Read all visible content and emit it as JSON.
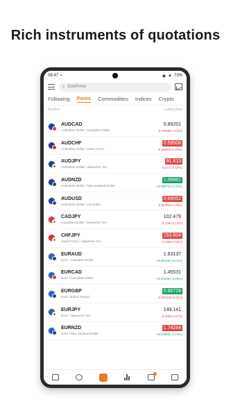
{
  "headline": "Rich instruments of quotations",
  "status": {
    "time": "08:47",
    "battery": "73%"
  },
  "search": {
    "placeholder": "DooPrime"
  },
  "tabs": [
    "Following",
    "Forex",
    "Commodities",
    "Indices",
    "Crypto"
  ],
  "active_tab": "Forex",
  "columns": {
    "symbol": "Symbol",
    "latest": "Latest price"
  },
  "rows": [
    {
      "symbol": "AUDCAD",
      "desc": "Australian Dollar / Canadian Dollar",
      "price": "0.89201",
      "change": "-0.00088(-0.03%)",
      "dir": "neutral",
      "chg": "neg"
    },
    {
      "symbol": "AUDCHF",
      "desc": "Australian Dollar / Swiss Franc",
      "price": "0.59508",
      "change": "-0.00050(-0.29%)",
      "dir": "down",
      "chg": "neg"
    },
    {
      "symbol": "AUDJPY",
      "desc": "Australian Dollar / Japanese Yen",
      "price": "91.413",
      "change": "-0.171(-0.19%)",
      "dir": "down",
      "chg": "neg"
    },
    {
      "symbol": "AUDNZD",
      "desc": "Australian Dollar / New Zealand Dollar",
      "price": "1.06861",
      "change": "+0.00071(+1.31%)",
      "dir": "up",
      "chg": "pos"
    },
    {
      "symbol": "AUDUSD",
      "desc": "Australian Dollar / US Dollar",
      "price": "0.66052",
      "change": "-0.00050(-0.26%)",
      "dir": "down",
      "chg": "neg"
    },
    {
      "symbol": "CADJPY",
      "desc": "Canadian Dollar / Japanese Yen",
      "price": "102.479",
      "change": "-0.138(-0.13%)",
      "dir": "neutral",
      "chg": "neg"
    },
    {
      "symbol": "CHFJPY",
      "desc": "Swiss Franc / Japanese Yen",
      "price": "153.604",
      "change": "-0.158(-0.10%)",
      "dir": "down",
      "chg": "neg"
    },
    {
      "symbol": "EURAUD",
      "desc": "Euro / Australian Dollar",
      "price": "1.63137",
      "change": "+0.00225(+0.14%)",
      "dir": "neutral",
      "chg": "pos"
    },
    {
      "symbol": "EURCAD",
      "desc": "Euro / Canadian Dollar",
      "price": "1.45531",
      "change": "+0.00136(+0.09%)",
      "dir": "neutral",
      "chg": "pos"
    },
    {
      "symbol": "EURGBP",
      "desc": "Euro / British Pound",
      "price": "0.86728",
      "change": "-0.00015(-0.02%)",
      "dir": "up",
      "chg": "neg"
    },
    {
      "symbol": "EURJPY",
      "desc": "Euro / Japanese Yen",
      "price": "149.141",
      "change": "-0.108(-0.07%)",
      "dir": "neutral",
      "chg": "neg"
    },
    {
      "symbol": "EURNZD",
      "desc": "Euro / New Zealand Dollar",
      "price": "1.74284",
      "change": "+0.01950(+1.13%)",
      "dir": "down",
      "chg": "pos"
    }
  ],
  "flags": {
    "AUD": "#1f3f8f",
    "CAD": "#e03a3a",
    "CHF": "#d8322c",
    "EUR": "#2f5fc2",
    "JPY": "#ffffff",
    "NZD": "#1f3f8f",
    "USD": "#2a4fa0",
    "GBP": "#2a3f8f"
  },
  "colors": {
    "accent": "#f07a1a",
    "up": "#1aa36a",
    "down": "#e04848"
  },
  "bottom_nav": [
    "home-icon",
    "feed-icon",
    "trade-icon",
    "chart-bars-icon",
    "message-icon",
    "profile-icon"
  ]
}
